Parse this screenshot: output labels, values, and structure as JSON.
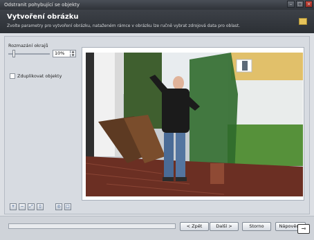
{
  "window": {
    "title": "Odstranit pohybující se objekty"
  },
  "header": {
    "title": "Vytvoření obrázku",
    "subtitle": "Zvolte parametry pro vytvoření obrázku, nataženém rámce v obrázku lze ručně vybrat zdrojová data pro oblast."
  },
  "left": {
    "blur_label": "Rozmazání okrajů",
    "blur_value": "10%",
    "blur_level_percent": 10,
    "duplicate_label": "Zduplikovat objekty",
    "duplicate_checked": false
  },
  "toolbar": {
    "icons": [
      "zoom-in-icon",
      "zoom-out-icon",
      "fit-icon",
      "actual-size-icon",
      "select-icon",
      "frame-icon"
    ]
  },
  "footer": {
    "back_label": "< Zpět",
    "next_label": "Další >",
    "cancel_label": "Storno",
    "help_label": "Nápověda"
  },
  "colors": {
    "header_bg": "#2f3339",
    "accent": "#e6c35a"
  }
}
